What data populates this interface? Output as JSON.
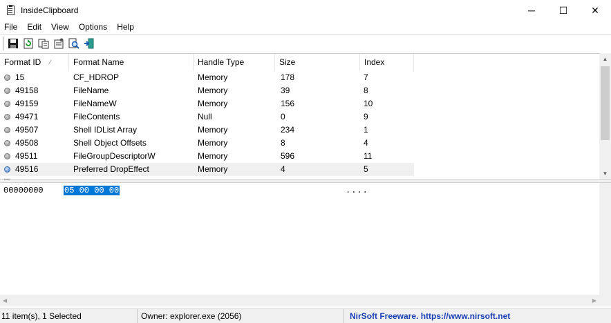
{
  "window": {
    "title": "InsideClipboard",
    "controls": {
      "minimize": "─",
      "maximize": "☐",
      "close": "✕"
    }
  },
  "menu": {
    "items": [
      {
        "label": "File"
      },
      {
        "label": "Edit"
      },
      {
        "label": "View"
      },
      {
        "label": "Options"
      },
      {
        "label": "Help"
      }
    ]
  },
  "toolbar": {
    "buttons": [
      {
        "icon": "save-icon"
      },
      {
        "icon": "refresh-icon"
      },
      {
        "icon": "copy-icon"
      },
      {
        "icon": "properties-icon"
      },
      {
        "icon": "find-icon"
      },
      {
        "icon": "exit-icon"
      }
    ]
  },
  "list": {
    "columns": [
      {
        "label": "Format ID",
        "sort": "ascending"
      },
      {
        "label": "Format Name"
      },
      {
        "label": "Handle Type"
      },
      {
        "label": "Size"
      },
      {
        "label": "Index"
      }
    ],
    "rows": [
      {
        "format_id": "15",
        "format_name": "CF_HDROP",
        "handle_type": "Memory",
        "size": "178",
        "index": "7",
        "icon": "gray-dot",
        "selected": false
      },
      {
        "format_id": "49158",
        "format_name": "FileName",
        "handle_type": "Memory",
        "size": "39",
        "index": "8",
        "icon": "gray-dot",
        "selected": false
      },
      {
        "format_id": "49159",
        "format_name": "FileNameW",
        "handle_type": "Memory",
        "size": "156",
        "index": "10",
        "icon": "gray-dot",
        "selected": false
      },
      {
        "format_id": "49471",
        "format_name": "FileContents",
        "handle_type": "Null",
        "size": "0",
        "index": "9",
        "icon": "gray-dot",
        "selected": false
      },
      {
        "format_id": "49507",
        "format_name": "Shell IDList Array",
        "handle_type": "Memory",
        "size": "234",
        "index": "1",
        "icon": "gray-dot",
        "selected": false
      },
      {
        "format_id": "49508",
        "format_name": "Shell Object Offsets",
        "handle_type": "Memory",
        "size": "8",
        "index": "4",
        "icon": "gray-dot",
        "selected": false
      },
      {
        "format_id": "49511",
        "format_name": "FileGroupDescriptorW",
        "handle_type": "Memory",
        "size": "596",
        "index": "11",
        "icon": "gray-dot",
        "selected": false
      },
      {
        "format_id": "49516",
        "format_name": "Preferred DropEffect",
        "handle_type": "Memory",
        "size": "4",
        "index": "5",
        "icon": "globe-dot",
        "selected": true
      }
    ]
  },
  "hex": {
    "offset": "00000000",
    "bytes": "05 00 00 00",
    "ascii": "...."
  },
  "status": {
    "items": "11 item(s), 1 Selected",
    "owner": "Owner: explorer.exe (2056)",
    "credit": "NirSoft Freeware.  https://www.nirsoft.net"
  },
  "colors": {
    "selection": "#0078d7",
    "credit_text": "#1a3fb5"
  }
}
